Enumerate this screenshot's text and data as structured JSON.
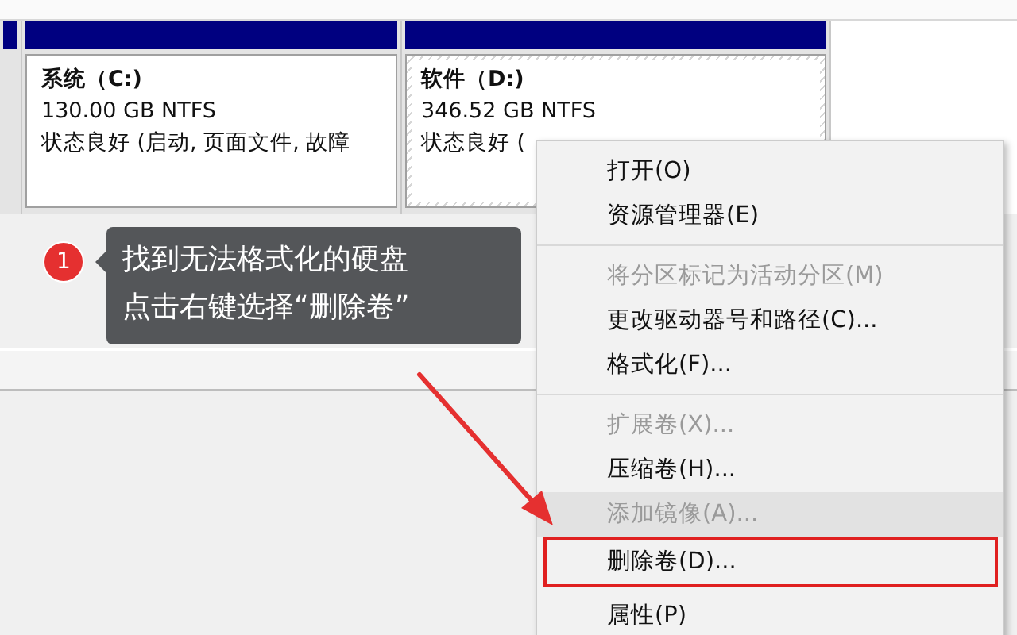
{
  "partitions": [
    {
      "kind": "stub"
    },
    {
      "kind": "volume",
      "name": "系统（C:)",
      "size": "130.00 GB NTFS",
      "status": "状态良好 (启动, 页面文件, 故障",
      "hatched": false
    },
    {
      "kind": "volume",
      "name": "软件（D:)",
      "size": "346.52 GB NTFS",
      "status": "状态良好 (",
      "hatched": true
    }
  ],
  "callout": {
    "step": "1",
    "lines": [
      "找到无法格式化的硬盘",
      "点击右键选择“删除卷”"
    ]
  },
  "context_menu": {
    "items": [
      {
        "kind": "item",
        "label": "打开(O)",
        "disabled": false,
        "hovered": false,
        "annotated": false
      },
      {
        "kind": "item",
        "label": "资源管理器(E)",
        "disabled": false,
        "hovered": false,
        "annotated": false
      },
      {
        "kind": "separator"
      },
      {
        "kind": "item",
        "label": "将分区标记为活动分区(M)",
        "disabled": true,
        "hovered": false,
        "annotated": false
      },
      {
        "kind": "item",
        "label": "更改驱动器号和路径(C)...",
        "disabled": false,
        "hovered": false,
        "annotated": false
      },
      {
        "kind": "item",
        "label": "格式化(F)...",
        "disabled": false,
        "hovered": false,
        "annotated": false
      },
      {
        "kind": "separator"
      },
      {
        "kind": "item",
        "label": "扩展卷(X)...",
        "disabled": true,
        "hovered": false,
        "annotated": false
      },
      {
        "kind": "item",
        "label": "压缩卷(H)...",
        "disabled": false,
        "hovered": false,
        "annotated": false
      },
      {
        "kind": "item",
        "label": "添加镜像(A)...",
        "disabled": true,
        "hovered": true,
        "annotated": false
      },
      {
        "kind": "item",
        "label": "删除卷(D)...",
        "disabled": false,
        "hovered": false,
        "annotated": true
      },
      {
        "kind": "item",
        "label": "属性(P)",
        "disabled": false,
        "hovered": false,
        "annotated": false
      }
    ]
  }
}
